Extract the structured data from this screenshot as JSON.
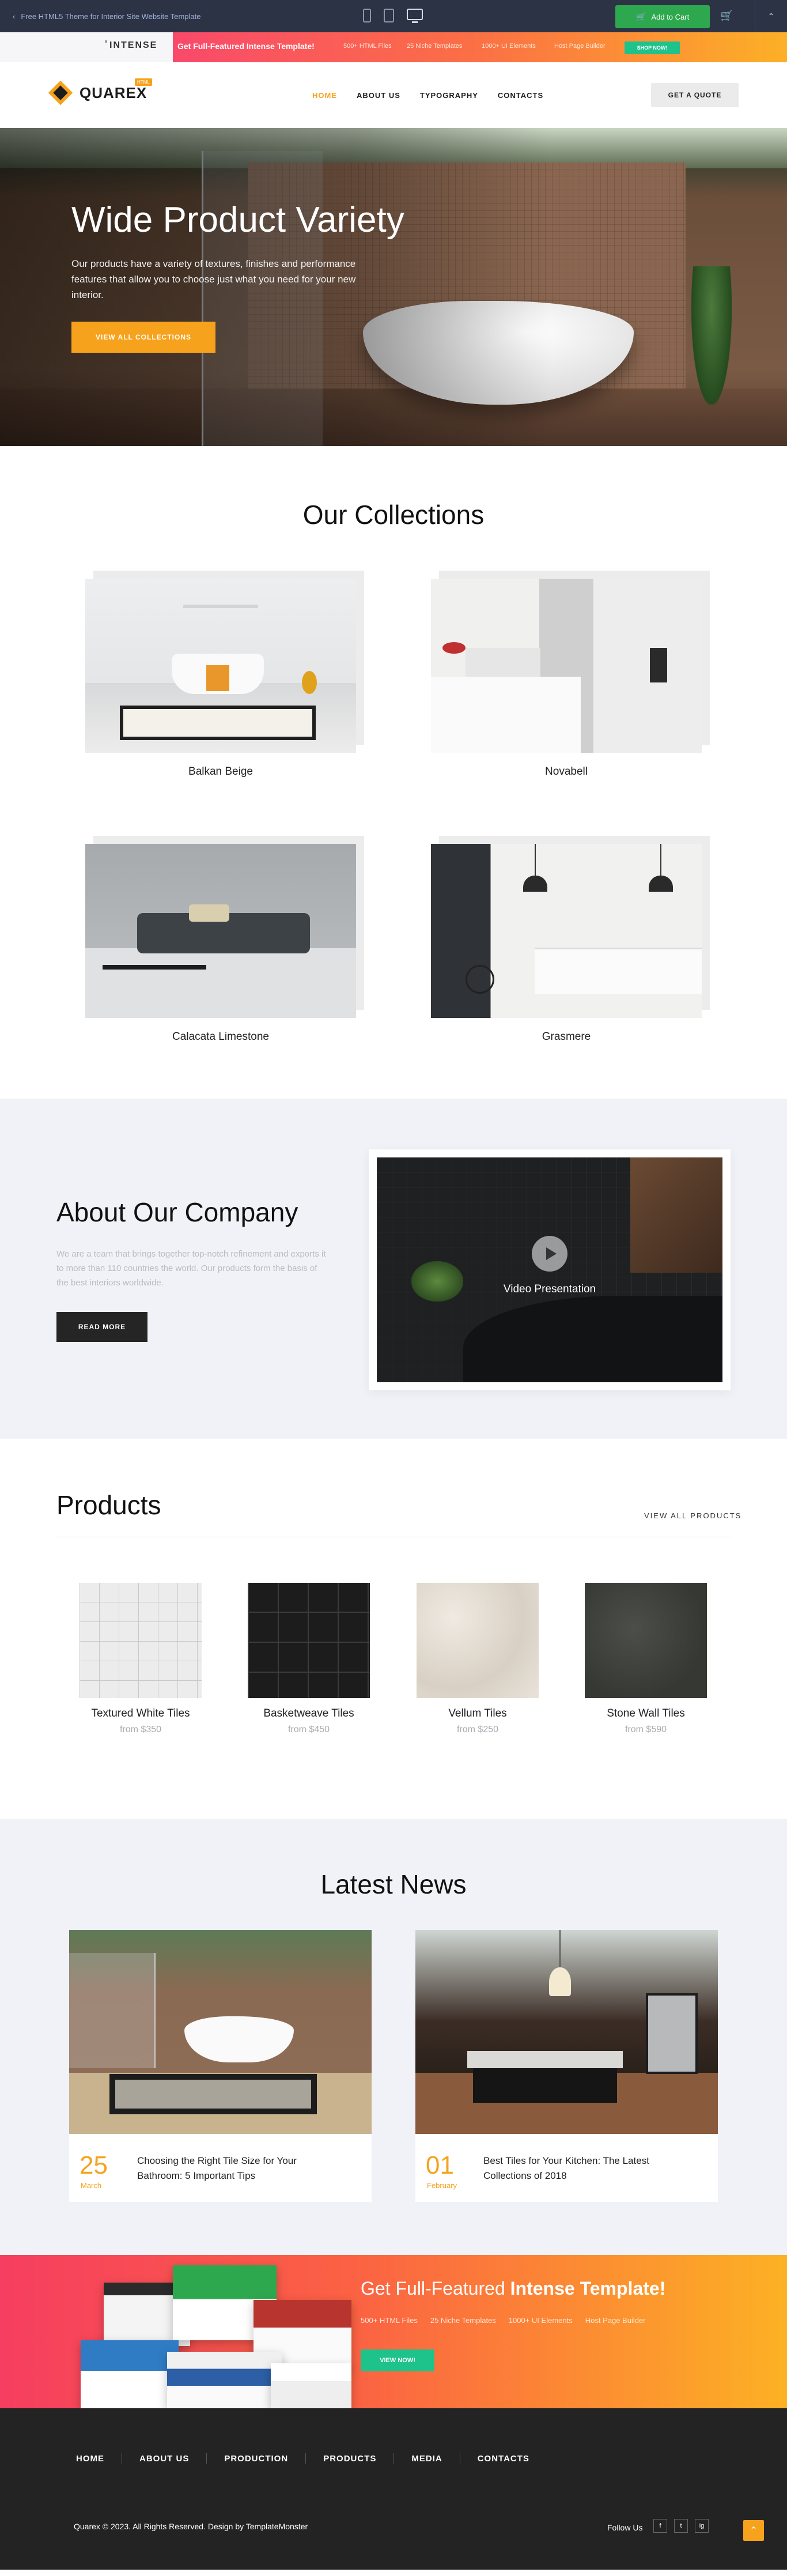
{
  "topbar": {
    "back_label": "Free HTML5 Theme for Interior Site Website Template",
    "cart_label": "Add to Cart"
  },
  "promo": {
    "brand": "INTENSE",
    "headline": "Get Full-Featured Intense Template!",
    "features": [
      "500+ HTML Files",
      "25 Niche Templates",
      "1000+ UI Elements",
      "Host Page Builder"
    ],
    "shop_label": "SHOP NOW!"
  },
  "header": {
    "logo_text": "QUAREX",
    "logo_badge": "HTML",
    "nav": [
      "HOME",
      "ABOUT US",
      "TYPOGRAPHY",
      "CONTACTS"
    ],
    "quote_label": "GET A QUOTE"
  },
  "hero": {
    "title": "Wide Product Variety",
    "text": "Our products have a variety of textures, finishes and performance features that allow you to choose just what you need for your new interior.",
    "cta": "VIEW ALL COLLECTIONS"
  },
  "collections": {
    "title": "Our Collections",
    "items": [
      "Balkan Beige",
      "Novabell",
      "Calacata Limestone",
      "Grasmere"
    ]
  },
  "about": {
    "title": "About Our Company",
    "text": "We are a team that brings together top-notch refinement and exports it to more than 110 countries the world. Our products form the basis of the best interiors worldwide.",
    "button": "READ MORE",
    "video_label": "Video Presentation"
  },
  "products": {
    "title": "Products",
    "view_all": "VIEW ALL PRODUCTS",
    "items": [
      {
        "name": "Textured White Tiles",
        "price": "from $350"
      },
      {
        "name": "Basketweave Tiles",
        "price": "from $450"
      },
      {
        "name": "Vellum Tiles",
        "price": "from $250"
      },
      {
        "name": "Stone Wall Tiles",
        "price": "from $590"
      }
    ]
  },
  "news": {
    "title": "Latest News",
    "posts": [
      {
        "day": "25",
        "month": "March",
        "title": "Choosing the Right Tile Size for Your Bathroom: 5 Important Tips"
      },
      {
        "day": "01",
        "month": "February",
        "title": "Best Tiles for Your Kitchen: The Latest Collections of 2018"
      }
    ]
  },
  "banner": {
    "title_pre": "Get Full-Featured ",
    "title_bold": "Intense Template!",
    "features": [
      "500+ HTML Files",
      "25 Niche Templates",
      "1000+ UI Elements",
      "Host Page Builder"
    ],
    "button": "VIEW NOW!"
  },
  "footer": {
    "nav": [
      "HOME",
      "ABOUT US",
      "PRODUCTION",
      "PRODUCTS",
      "MEDIA",
      "CONTACTS"
    ],
    "copyright": "Quarex © 2023. All Rights Reserved. Design by TemplateMonster",
    "follow": "Follow Us",
    "social": [
      "f",
      "t",
      "ig"
    ]
  }
}
